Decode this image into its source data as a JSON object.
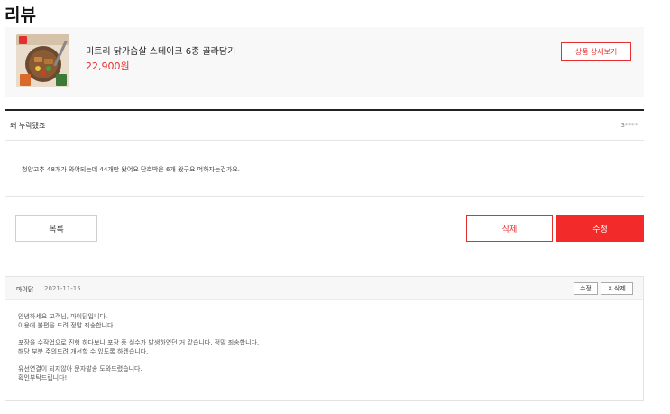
{
  "page": {
    "title": "리뷰"
  },
  "product": {
    "name": "미트리 닭가슴살 스테이크 6종 골라담기",
    "price": "22,900원",
    "detail_button": "상품 상세보기",
    "thumbnail_icon": "product-thumbnail-image"
  },
  "review": {
    "title": "왜 누락됐죠",
    "author": "3****",
    "body": "청양고추 48개가 와야되는데 44개만 왔어요 단호박은 6개 왔구요 머하자는건가요."
  },
  "actions": {
    "list_label": "목록",
    "delete_label": "삭제",
    "edit_label": "수정"
  },
  "reply": {
    "author": "마이닭",
    "date": "2021-11-15",
    "edit_label": "수정",
    "delete_label": "삭제",
    "delete_icon": "×",
    "lines": [
      "안녕하세요 고객님, 마이닭입니다.",
      "이용에 불편을 드려 정말 죄송합니다.",
      "",
      "포장을 수작업으로 진행 하다보니 포장 중 실수가 발생하였던 거 같습니다. 정말 죄송합니다.",
      "해당 부분 주의드려 개선할 수 있도록 하겠습니다.",
      "",
      "유선연결이 되지않아 문자발송 도와드렸습니다.",
      "확인부탁드립니다!"
    ]
  },
  "colors": {
    "accent": "#f22a2a",
    "accent_text": "#e62e2e"
  }
}
